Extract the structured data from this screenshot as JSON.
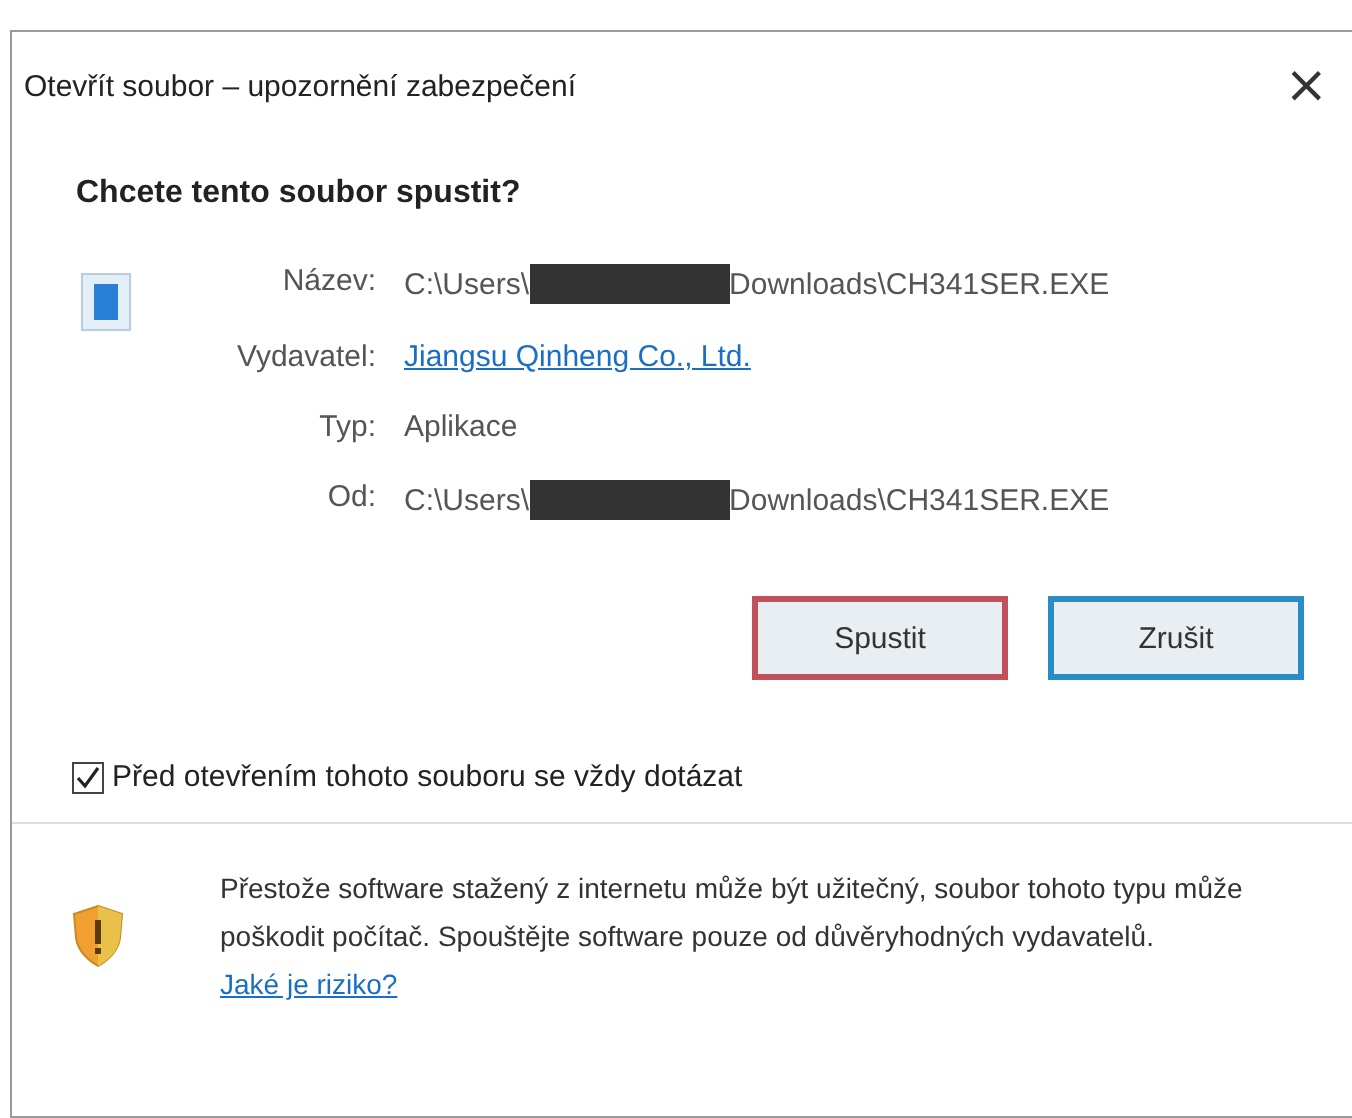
{
  "window": {
    "title": "Otevřít soubor – upozornění zabezpečení",
    "close": "×"
  },
  "heading": "Chcete tento soubor spustit?",
  "fields": [
    {
      "label": "Název:",
      "kind": "path",
      "prefix": "C:\\Users\\",
      "redacted": true,
      "suffix": "Downloads\\CH341SER.EXE"
    },
    {
      "label": "Vydavatel:",
      "kind": "link",
      "value": "Jiangsu Qinheng Co., Ltd."
    },
    {
      "label": "Typ:",
      "kind": "text",
      "value": "Aplikace"
    },
    {
      "label": "Od:",
      "kind": "path",
      "prefix": "C:\\Users\\",
      "redacted": true,
      "suffix": "Downloads\\CH341SER.EXE"
    }
  ],
  "buttons": [
    {
      "label": "Spustit",
      "highlighted": true,
      "focused": false
    },
    {
      "label": "Zrušit",
      "highlighted": false,
      "focused": true
    }
  ],
  "checkbox": {
    "label": "Před otevřením tohoto souboru se vždy dotázat",
    "checked": true
  },
  "warning": {
    "text": "Přestože software stažený z internetu může být užitečný, soubor tohoto typu může poškodit počítač. Spouštějte software pouze od důvěryhodných vydavatelů.",
    "link": "Jaké je riziko?"
  }
}
